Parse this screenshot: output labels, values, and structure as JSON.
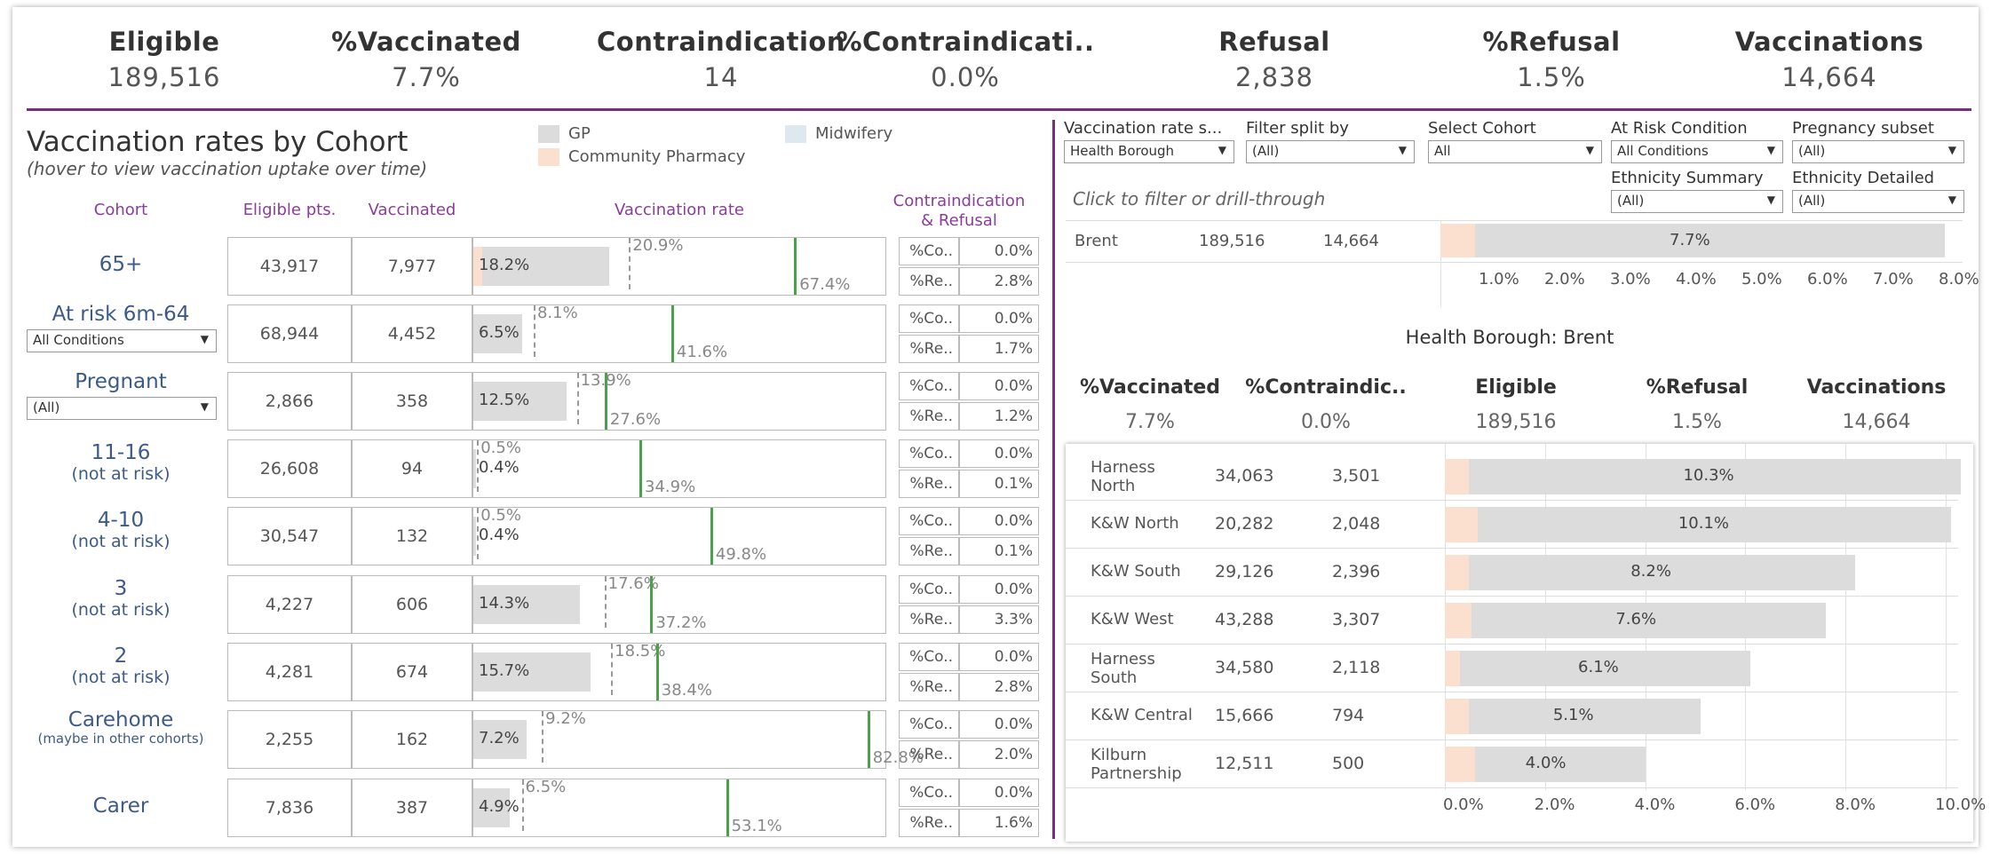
{
  "kpis": [
    {
      "label": "Eligible",
      "value": "189,516"
    },
    {
      "label": "%Vaccinated",
      "value": "7.7%"
    },
    {
      "label": "Contraindication",
      "value": "14"
    },
    {
      "label": "%Contraindicati..",
      "value": "0.0%"
    },
    {
      "label": "Refusal",
      "value": "2,838"
    },
    {
      "label": "%Refusal",
      "value": "1.5%"
    },
    {
      "label": "Vaccinations",
      "value": "14,664"
    }
  ],
  "colors": {
    "accent": "#7b2d7f",
    "gp": "#dcdcdc",
    "pharmacy": "#fbe0cf",
    "midwifery": "#dde9ee",
    "target": "#4aa14a"
  },
  "left": {
    "title": "Vaccination rates by Cohort",
    "subtitle": "(hover to view vaccination uptake over time)",
    "legend": [
      "GP",
      "Midwifery",
      "Community Pharmacy"
    ],
    "headers": {
      "cohort": "Cohort",
      "eligible": "Eligible pts.",
      "vaccinated": "Vaccinated",
      "rate": "Vaccination rate",
      "cr1": "Contraindication",
      "cr2": "& Refusal"
    },
    "cr_labels": {
      "contra": "%Co..",
      "refusal": "%Re.."
    }
  },
  "cohorts": [
    {
      "name": "65+",
      "sub": "",
      "eligible": "43,917",
      "vaccinated": "7,977",
      "rate": 18.2,
      "rate_label": "18.2%",
      "prev": 20.9,
      "prev_label": "20.9%",
      "target": 67.4,
      "target_label": "67.4%",
      "contra": "0.0%",
      "refusal": "2.8%",
      "pharm": 1.2
    },
    {
      "name": "At risk 6m-64",
      "dropdown": "All Conditions",
      "eligible": "68,944",
      "vaccinated": "4,452",
      "rate": 6.5,
      "rate_label": "6.5%",
      "prev": 8.1,
      "prev_label": "8.1%",
      "target": 41.6,
      "target_label": "41.6%",
      "contra": "0.0%",
      "refusal": "1.7%",
      "pharm": 0
    },
    {
      "name": "Pregnant",
      "dropdown": "(All)",
      "eligible": "2,866",
      "vaccinated": "358",
      "rate": 12.5,
      "rate_label": "12.5%",
      "prev": 13.9,
      "prev_label": "13.9%",
      "target": 27.6,
      "target_label": "27.6%",
      "contra": "0.0%",
      "refusal": "1.2%",
      "pharm": 0
    },
    {
      "name": "11-16",
      "sub": "(not at risk)",
      "eligible": "26,608",
      "vaccinated": "94",
      "rate": 0.4,
      "rate_label": "0.4%",
      "prev": 0.5,
      "prev_label": "0.5%",
      "target": 34.9,
      "target_label": "34.9%",
      "contra": "0.0%",
      "refusal": "0.1%",
      "pharm": 0
    },
    {
      "name": "4-10",
      "sub": "(not at risk)",
      "eligible": "30,547",
      "vaccinated": "132",
      "rate": 0.4,
      "rate_label": "0.4%",
      "prev": 0.5,
      "prev_label": "0.5%",
      "target": 49.8,
      "target_label": "49.8%",
      "contra": "0.0%",
      "refusal": "0.1%",
      "pharm": 0
    },
    {
      "name": "3",
      "sub": "(not at risk)",
      "eligible": "4,227",
      "vaccinated": "606",
      "rate": 14.3,
      "rate_label": "14.3%",
      "prev": 17.6,
      "prev_label": "17.6%",
      "target": 37.2,
      "target_label": "37.2%",
      "contra": "0.0%",
      "refusal": "3.3%",
      "pharm": 0
    },
    {
      "name": "2",
      "sub": "(not at risk)",
      "eligible": "4,281",
      "vaccinated": "674",
      "rate": 15.7,
      "rate_label": "15.7%",
      "prev": 18.5,
      "prev_label": "18.5%",
      "target": 38.4,
      "target_label": "38.4%",
      "contra": "0.0%",
      "refusal": "2.8%",
      "pharm": 0
    },
    {
      "name": "Carehome",
      "sub_small": "(maybe in other cohorts)",
      "eligible": "2,255",
      "vaccinated": "162",
      "rate": 7.2,
      "rate_label": "7.2%",
      "prev": 9.2,
      "prev_label": "9.2%",
      "target": 82.8,
      "target_label": "82.8%",
      "contra": "0.0%",
      "refusal": "2.0%",
      "pharm": 0
    },
    {
      "name": "Carer",
      "sub": "",
      "eligible": "7,836",
      "vaccinated": "387",
      "rate": 4.9,
      "rate_label": "4.9%",
      "prev": 6.5,
      "prev_label": "6.5%",
      "target": 53.1,
      "target_label": "53.1%",
      "contra": "0.0%",
      "refusal": "1.6%",
      "pharm": 0
    }
  ],
  "filters": [
    {
      "label": "Vaccination rate s...",
      "value": "Health Borough"
    },
    {
      "label": "Filter split by",
      "value": "(All)"
    },
    {
      "label": "Select Cohort",
      "value": "All"
    },
    {
      "label": "At Risk Condition",
      "value": "All Conditions"
    },
    {
      "label": "Pregnancy subset",
      "value": "(All)"
    },
    {
      "label": "Ethnicity Summary",
      "value": "(All)"
    },
    {
      "label": "Ethnicity Detailed",
      "value": "(All)"
    }
  ],
  "right": {
    "hint": "Click to filter or drill-through",
    "brent": {
      "name": "Brent",
      "eligible": "189,516",
      "vaccinations": "14,664",
      "rate": 7.7,
      "rate_label": "7.7%",
      "pharm": 0.4
    },
    "brent_axis": [
      "1.0%",
      "2.0%",
      "3.0%",
      "4.0%",
      "5.0%",
      "6.0%",
      "7.0%",
      "8.0%"
    ],
    "hb_title": "Health Borough: Brent",
    "kpis": [
      {
        "label": "%Vaccinated",
        "value": "7.7%"
      },
      {
        "label": "%Contraindic..",
        "value": "0.0%"
      },
      {
        "label": "Eligible",
        "value": "189,516"
      },
      {
        "label": "%Refusal",
        "value": "1.5%"
      },
      {
        "label": "Vaccinations",
        "value": "14,664"
      }
    ],
    "areas": [
      {
        "name": "Harness North",
        "eligible": "34,063",
        "vaccinated": "3,501",
        "rate": 10.3,
        "rate_label": "10.3%",
        "pharm": 0.8
      },
      {
        "name": "K&W North",
        "eligible": "20,282",
        "vaccinated": "2,048",
        "rate": 10.1,
        "rate_label": "10.1%",
        "pharm": 1.1
      },
      {
        "name": "K&W South",
        "eligible": "29,126",
        "vaccinated": "2,396",
        "rate": 8.2,
        "rate_label": "8.2%",
        "pharm": 0.8
      },
      {
        "name": "K&W West",
        "eligible": "43,288",
        "vaccinated": "3,307",
        "rate": 7.6,
        "rate_label": "7.6%",
        "pharm": 0.9
      },
      {
        "name": "Harness South",
        "eligible": "34,580",
        "vaccinated": "2,118",
        "rate": 6.1,
        "rate_label": "6.1%",
        "pharm": 0.5
      },
      {
        "name": "K&W Central",
        "eligible": "15,666",
        "vaccinated": "794",
        "rate": 5.1,
        "rate_label": "5.1%",
        "pharm": 0.8
      },
      {
        "name": "Kilburn Partnership",
        "eligible": "12,511",
        "vaccinated": "500",
        "rate": 4.0,
        "rate_label": "4.0%",
        "pharm": 1.0
      }
    ],
    "area_axis": [
      "0.0%",
      "2.0%",
      "4.0%",
      "6.0%",
      "8.0%",
      "10.0%"
    ]
  }
}
